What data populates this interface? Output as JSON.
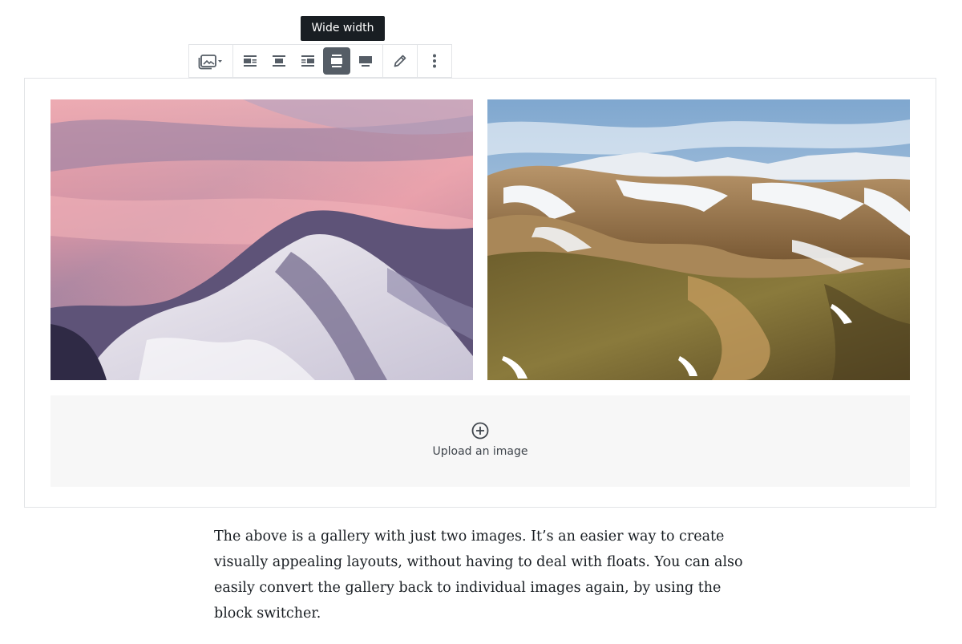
{
  "tooltip": {
    "text": "Wide width"
  },
  "toolbar": {
    "buttons": [
      {
        "id": "block-switcher",
        "icon": "gallery-icon"
      },
      {
        "id": "align-left",
        "icon": "align-left-icon"
      },
      {
        "id": "align-center",
        "icon": "align-center-icon"
      },
      {
        "id": "align-right",
        "icon": "align-right-icon"
      },
      {
        "id": "align-wide",
        "icon": "align-wide-icon",
        "active": true
      },
      {
        "id": "align-full",
        "icon": "align-full-width-icon"
      },
      {
        "id": "edit",
        "icon": "pencil-icon"
      },
      {
        "id": "more",
        "icon": "more-vertical-icon"
      }
    ]
  },
  "gallery": {
    "images": [
      {
        "subject": "pink-sky-over-snowy-mountains"
      },
      {
        "subject": "snow-streaked-highland-hills"
      }
    ],
    "uploader": {
      "label": "Upload an image",
      "icon": "plus-circle-icon"
    }
  },
  "paragraph": {
    "text": "The above is a gallery with just two images. It’s an easier way to create visually appealing layouts, without having to deal with floats. You can also easily convert the gallery back to individual images again, by using the block switcher."
  },
  "colors": {
    "toolbar_active": "#555d66",
    "tooltip_bg": "#191e23",
    "border": "#e2e4e7",
    "uploader_bg": "#f7f7f7"
  }
}
